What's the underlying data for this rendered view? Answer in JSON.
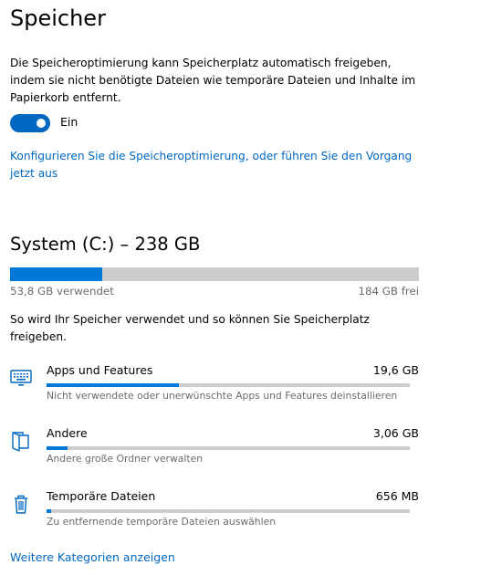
{
  "storage_sense": {
    "title": "Speicher",
    "description": "Die Speicheroptimierung kann Speicherplatz automatisch freigeben, indem sie nicht benötigte Dateien wie temporäre Dateien und Inhalte im Papierkorb entfernt.",
    "toggle_state_label": "Ein",
    "toggle_on": true,
    "configure_link": "Konfigurieren Sie die Speicheroptimierung, oder führen Sie den Vorgang jetzt aus"
  },
  "drive": {
    "title": "System (C:) – 238 GB",
    "used_label": "53,8 GB verwendet",
    "free_label": "184 GB frei",
    "used_fraction": 0.226,
    "intro": "So wird Ihr Speicher verwendet und so können Sie Speicherplatz freigeben."
  },
  "categories": [
    {
      "name": "Apps und Features",
      "size": "19,6 GB",
      "description": "Nicht verwendete oder unerwünschte Apps und Features deinstallieren",
      "fraction": 0.365,
      "icon": "keyboard-icon"
    },
    {
      "name": "Andere",
      "size": "3,06 GB",
      "description": "Andere große Ordner verwalten",
      "fraction": 0.057,
      "icon": "folder-icon"
    },
    {
      "name": "Temporäre Dateien",
      "size": "656 MB",
      "description": "Zu entfernende temporäre Dateien auswählen",
      "fraction": 0.012,
      "icon": "trash-icon"
    }
  ],
  "more_link": "Weitere Kategorien anzeigen",
  "colors": {
    "accent": "#0067c0",
    "bar_fill": "#0078d7",
    "bar_track": "#cccccc",
    "secondary_text": "#6b6b6b"
  }
}
